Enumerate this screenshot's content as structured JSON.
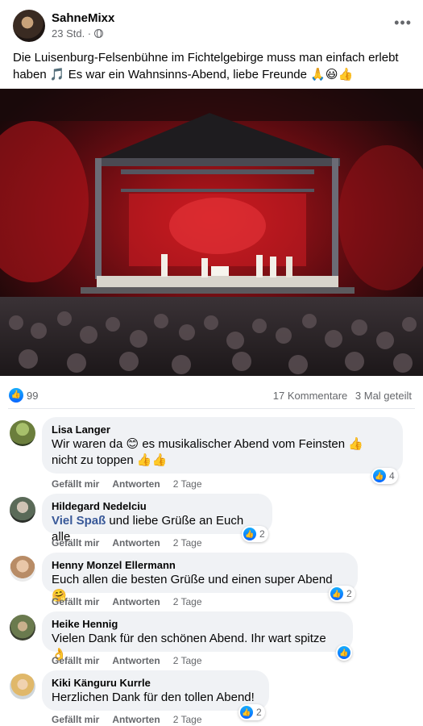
{
  "post": {
    "author": "SahneMixx",
    "time": "23 Std. ·",
    "text": "Die Luisenburg-Felsenbühne im Fichtelgebirge muss man einfach erlebt haben 🎵 Es war ein Wahnsinns-Abend, liebe Freunde 🙏😃👍",
    "reactions_count": "99",
    "comments_count": "17 Kommentare",
    "shares_count": "3 Mal geteilt",
    "more_icon": "more-horizontal-icon",
    "privacy_icon": "globe-icon"
  },
  "comments": [
    {
      "name": "Lisa Langer",
      "text_line1": "Wir waren da 😊 es musikalischer Abend vom Feinsten 👍",
      "text_line2": "nicht zu toppen 👍👍",
      "like": "Gefällt mir",
      "reply": "Antworten",
      "time": "2 Tage",
      "reactions": "4"
    },
    {
      "name": "Hildegard Nedelciu",
      "link_text": "Viel Spaß",
      "text": " und liebe Grüße an Euch alle",
      "like": "Gefällt mir",
      "reply": "Antworten",
      "time": "2 Tage",
      "reactions": "2"
    },
    {
      "name": "Henny Monzel Ellermann",
      "text": "Euch allen die besten Grüße und einen super Abend 🤗",
      "like": "Gefällt mir",
      "reply": "Antworten",
      "time": "2 Tage",
      "reactions": "2"
    },
    {
      "name": "Heike Hennig",
      "text": "Vielen Dank für den schönen Abend. Ihr wart spitze 👌",
      "like": "Gefällt mir",
      "reply": "Antworten",
      "time": "2 Tage",
      "reactions": ""
    },
    {
      "name": "Kiki Känguru Kurrle",
      "text": "Herzlichen Dank für den tollen Abend!",
      "like": "Gefällt mir",
      "reply": "Antworten",
      "time": "2 Tage",
      "reactions": "2"
    }
  ],
  "colors": {
    "like_blue": "#0866ff",
    "bubble_bg": "#f0f2f5",
    "secondary_text": "#65676b",
    "link": "#385898"
  }
}
